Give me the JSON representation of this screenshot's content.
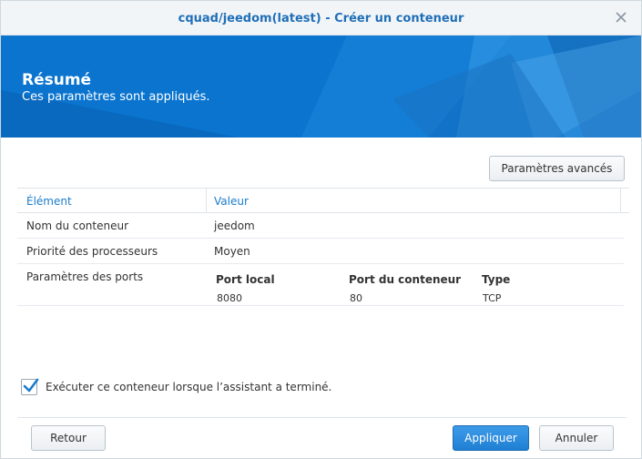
{
  "window": {
    "title": "cquad/jeedom(latest) - Créer un conteneur"
  },
  "banner": {
    "heading": "Résumé",
    "subheading": "Ces paramètres sont appliqués."
  },
  "toolbar": {
    "advanced_label": "Paramètres avancés"
  },
  "table": {
    "columns": [
      "Élément",
      "Valeur"
    ],
    "rows": [
      {
        "key": "Nom du conteneur",
        "value": "jeedom"
      },
      {
        "key": "Priorité des processeurs",
        "value": "Moyen"
      },
      {
        "key": "Paramètres des ports"
      }
    ],
    "ports": {
      "headers": [
        "Port local",
        "Port du conteneur",
        "Type"
      ],
      "values": [
        "8080",
        "80",
        "TCP"
      ]
    }
  },
  "options": {
    "run_after_label": "Exécuter ce conteneur lorsque l’assistant a terminé.",
    "run_after_checked": true
  },
  "footer": {
    "back_label": "Retour",
    "apply_label": "Appliquer",
    "cancel_label": "Annuler"
  },
  "colors": {
    "accent": "#1a7ccc",
    "banner": "#0a74cf",
    "primary_button": "#2a8adb"
  },
  "icons": {
    "close": "close-icon",
    "checkbox": "checkmark-icon"
  }
}
